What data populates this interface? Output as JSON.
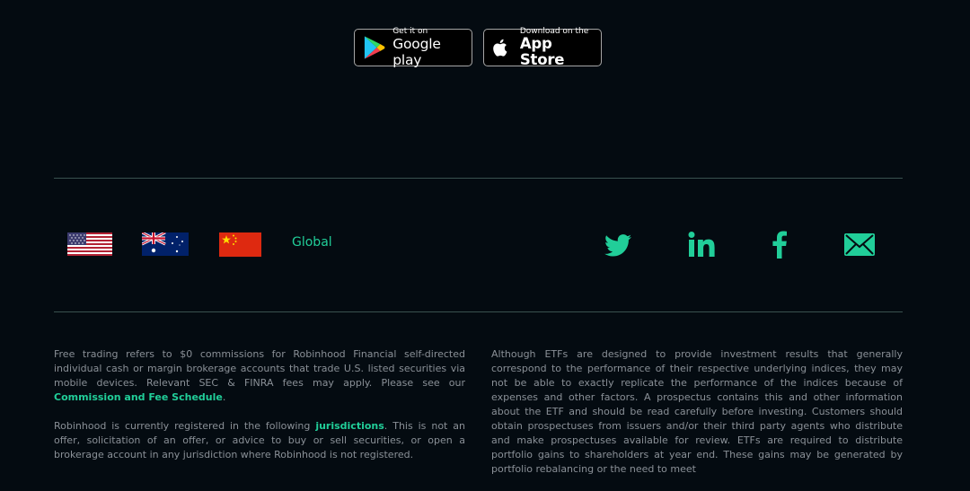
{
  "app_badges": {
    "google": {
      "small": "Get it on",
      "big": "Google play"
    },
    "apple": {
      "small": "Download on the",
      "big": "App Store"
    }
  },
  "regions": {
    "flags": [
      "us-flag",
      "au-flag",
      "cn-flag"
    ],
    "global_label": "Global"
  },
  "social": [
    "twitter-icon",
    "linkedin-icon",
    "facebook-icon",
    "email-icon"
  ],
  "colors": {
    "background": "#040b11",
    "accent": "#21ce99",
    "text": "#8a9097",
    "divider": "#39524f"
  },
  "disclosures": {
    "left_p1_a": "Free trading refers to $0 commissions for Robinhood Financial self-directed individual cash or margin brokerage accounts that trade U.S. listed securities via mobile devices. Relevant SEC & FINRA fees may apply. Please see our ",
    "left_p1_link": "Commission and Fee Schedule",
    "left_p1_b": ".",
    "left_p2_a": "Robinhood is currently registered in the following ",
    "left_p2_link": "jurisdictions",
    "left_p2_b": ". This is not an offer, solicitation of an offer, or advice to buy or sell securities, or open a brokerage account in any jurisdiction where Robinhood is not registered.",
    "right_p1": "Although ETFs are designed to provide investment results that generally correspond to the performance of their respective underlying indices, they may not be able to exactly replicate the performance of the indices because of expenses and other factors. A prospectus contains this and other information about the ETF and should be read carefully before investing. Customers should obtain prospectuses from issuers and/or their third party agents who distribute and make prospectuses available for review. ETFs are required to distribute portfolio gains to shareholders at year end. These gains may be generated by portfolio rebalancing or the need to meet"
  }
}
